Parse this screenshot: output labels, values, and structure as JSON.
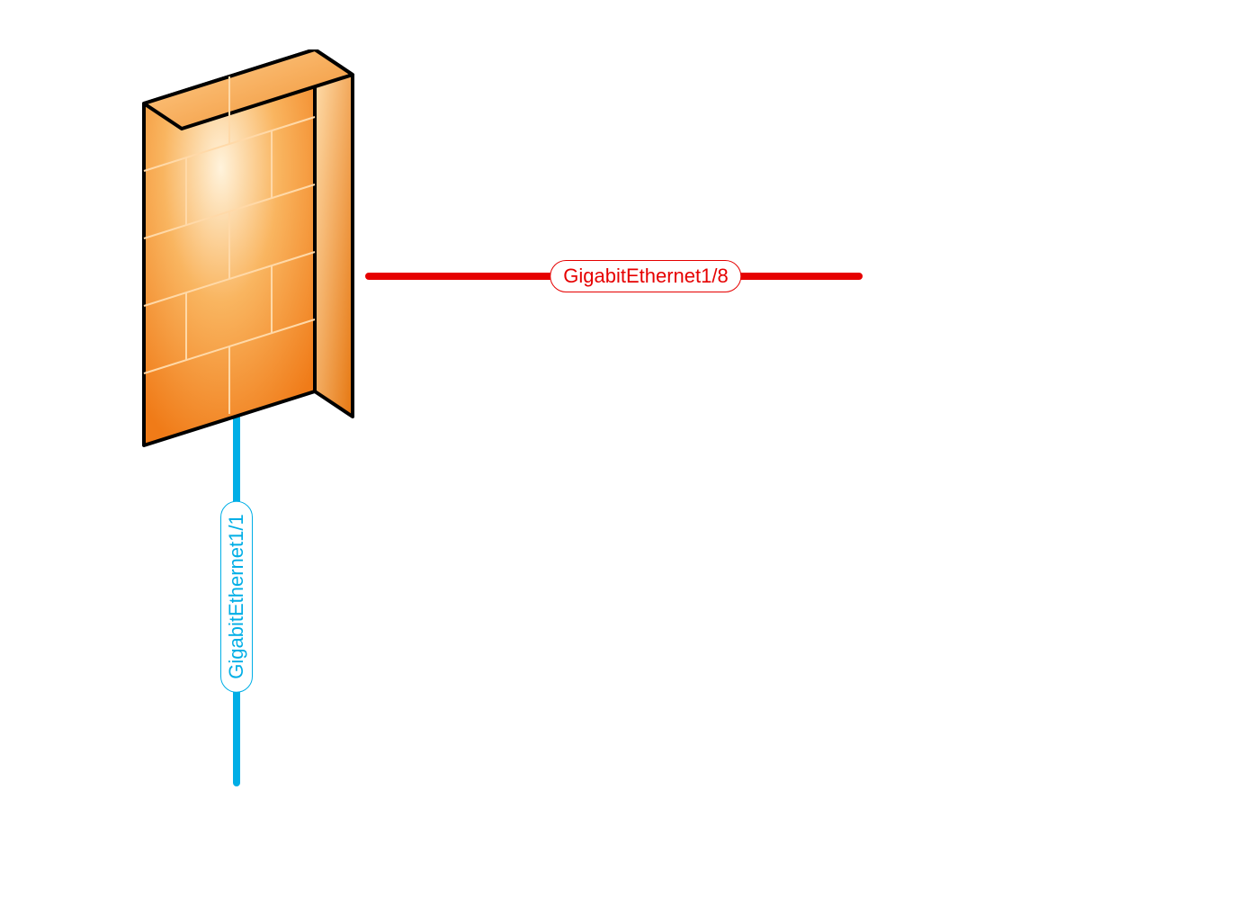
{
  "interfaces": {
    "right": {
      "label": "GigabitEthernet1/8"
    },
    "down": {
      "label": "GigabitEthernet1/1"
    }
  },
  "colors": {
    "right_line": "#e60000",
    "down_line": "#00aee6",
    "firewall_fill_a": "#f28c1d",
    "firewall_fill_b": "#ffd9a0",
    "firewall_stroke": "#000000"
  }
}
